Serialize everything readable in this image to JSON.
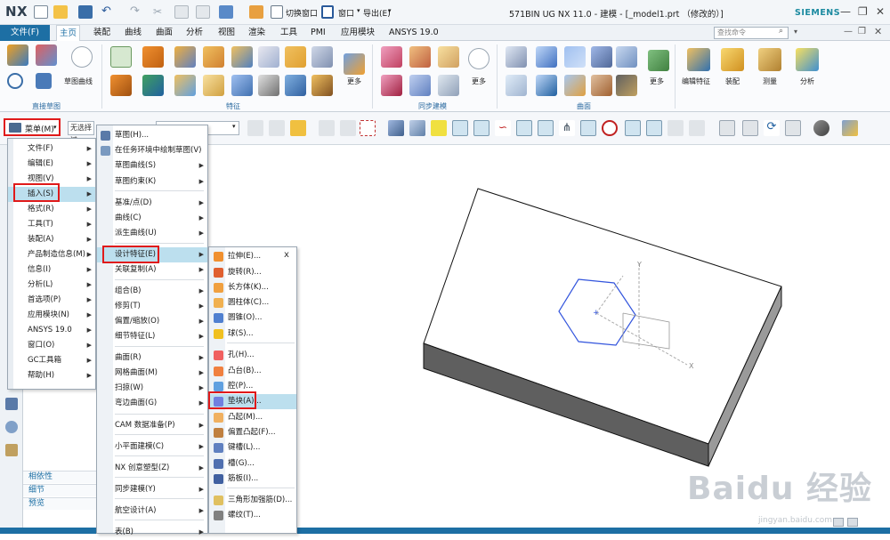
{
  "app": {
    "logo": "NX",
    "window_title": "571BIN UG NX 11.0 - 建模 - [_model1.prt （修改的）]",
    "brand": "SIEMENS",
    "qa_switch_window": "切换窗口",
    "qa_window": "窗口",
    "qa_export": "导出(E)",
    "window_controls": [
      "—",
      "❐",
      "✕"
    ]
  },
  "tabs": {
    "file": "文件(F)",
    "items": [
      "主页",
      "装配",
      "曲线",
      "曲面",
      "分析",
      "视图",
      "渲染",
      "工具",
      "PMI",
      "应用模块",
      "ANSYS 19.0"
    ],
    "active": "主页",
    "search_placeholder": "查找命令"
  },
  "ribbon": {
    "groups": [
      "直接草图",
      "特征",
      "同步建模",
      "曲面"
    ],
    "labels": {
      "sketch_curve": "草图曲线",
      "more1": "更多",
      "more2": "更多",
      "more3": "更多",
      "edit_feature": "编辑特征",
      "assembly": "装配",
      "measure": "测量",
      "analysis": "分析"
    }
  },
  "toolbar": {
    "menu_label": "菜单(M)",
    "filter_label": "无选择过",
    "assembly_combo": ""
  },
  "menu_main": {
    "items": [
      {
        "label": "文件(F)",
        "sub": true
      },
      {
        "label": "编辑(E)",
        "sub": true
      },
      {
        "label": "视图(V)",
        "sub": true
      },
      {
        "label": "插入(S)",
        "sub": true,
        "highlight": true
      },
      {
        "label": "格式(R)",
        "sub": true
      },
      {
        "label": "工具(T)",
        "sub": true
      },
      {
        "label": "装配(A)",
        "sub": true
      },
      {
        "label": "产品制造信息(M)",
        "sub": true
      },
      {
        "label": "信息(I)",
        "sub": true
      },
      {
        "label": "分析(L)",
        "sub": true
      },
      {
        "label": "首选项(P)",
        "sub": true
      },
      {
        "label": "应用模块(N)",
        "sub": true
      },
      {
        "label": "ANSYS 19.0",
        "sub": true
      },
      {
        "label": "窗口(O)",
        "sub": true
      },
      {
        "label": "GC工具箱",
        "sub": true
      },
      {
        "label": "帮助(H)",
        "sub": true
      }
    ]
  },
  "menu_insert": {
    "items": [
      {
        "label": "草图(H)...",
        "sub": false
      },
      {
        "label": "在任务环境中绘制草图(V)",
        "sub": false
      },
      {
        "label": "草图曲线(S)",
        "sub": true
      },
      {
        "label": "草图约束(K)",
        "sub": true
      },
      {
        "label": "基准/点(D)",
        "sub": true
      },
      {
        "label": "曲线(C)",
        "sub": true
      },
      {
        "label": "派生曲线(U)",
        "sub": true
      },
      {
        "label": "设计特征(E)",
        "sub": true,
        "highlight": true
      },
      {
        "label": "关联复制(A)",
        "sub": true
      },
      {
        "label": "组合(B)",
        "sub": true
      },
      {
        "label": "修剪(T)",
        "sub": true
      },
      {
        "label": "偏置/缩放(O)",
        "sub": true
      },
      {
        "label": "细节特征(L)",
        "sub": true
      },
      {
        "label": "曲面(R)",
        "sub": true
      },
      {
        "label": "网格曲面(M)",
        "sub": true
      },
      {
        "label": "扫掠(W)",
        "sub": true
      },
      {
        "label": "弯边曲面(G)",
        "sub": true
      },
      {
        "label": "CAM 数据准备(P)",
        "sub": true
      },
      {
        "label": "小平面建模(C)",
        "sub": true
      },
      {
        "label": "NX 创意塑型(Z)",
        "sub": true
      },
      {
        "label": "同步建模(Y)",
        "sub": true
      },
      {
        "label": "航空设计(A)",
        "sub": true
      },
      {
        "label": "表(B)",
        "sub": true
      }
    ]
  },
  "menu_design": {
    "close": "x",
    "items": [
      {
        "label": "拉伸(E)...",
        "icon": "extrude-icon"
      },
      {
        "label": "旋转(R)...",
        "icon": "revolve-icon"
      },
      {
        "label": "长方体(K)...",
        "icon": "block-icon"
      },
      {
        "label": "圆柱体(C)...",
        "icon": "cylinder-icon"
      },
      {
        "label": "圆锥(O)...",
        "icon": "cone-icon"
      },
      {
        "label": "球(S)...",
        "icon": "sphere-icon"
      },
      {
        "label": "孔(H)...",
        "icon": "hole-icon"
      },
      {
        "label": "凸台(B)...",
        "icon": "boss-icon"
      },
      {
        "label": "腔(P)...",
        "icon": "pocket-icon"
      },
      {
        "label": "垫块(A)...",
        "icon": "pad-icon",
        "highlight": true
      },
      {
        "label": "凸起(M)...",
        "icon": "emboss-icon"
      },
      {
        "label": "偏置凸起(F)...",
        "icon": "offset-emboss-icon"
      },
      {
        "label": "键槽(L)...",
        "icon": "slot-icon"
      },
      {
        "label": "槽(G)...",
        "icon": "groove-icon"
      },
      {
        "label": "筋板(I)...",
        "icon": "rib-icon"
      },
      {
        "label": "三角形加强筋(D)...",
        "icon": "dart-icon"
      },
      {
        "label": "螺纹(T)...",
        "icon": "thread-icon"
      }
    ]
  },
  "navpanel": {
    "sections": [
      "相依性",
      "细节",
      "预览"
    ]
  },
  "watermark": {
    "main": "Baidu 经验",
    "url": "jingyan.baidu.com"
  },
  "colors": {
    "accent": "#1d6fa4",
    "highlight": "#bcdfee",
    "red_box": "#e01a1a"
  }
}
